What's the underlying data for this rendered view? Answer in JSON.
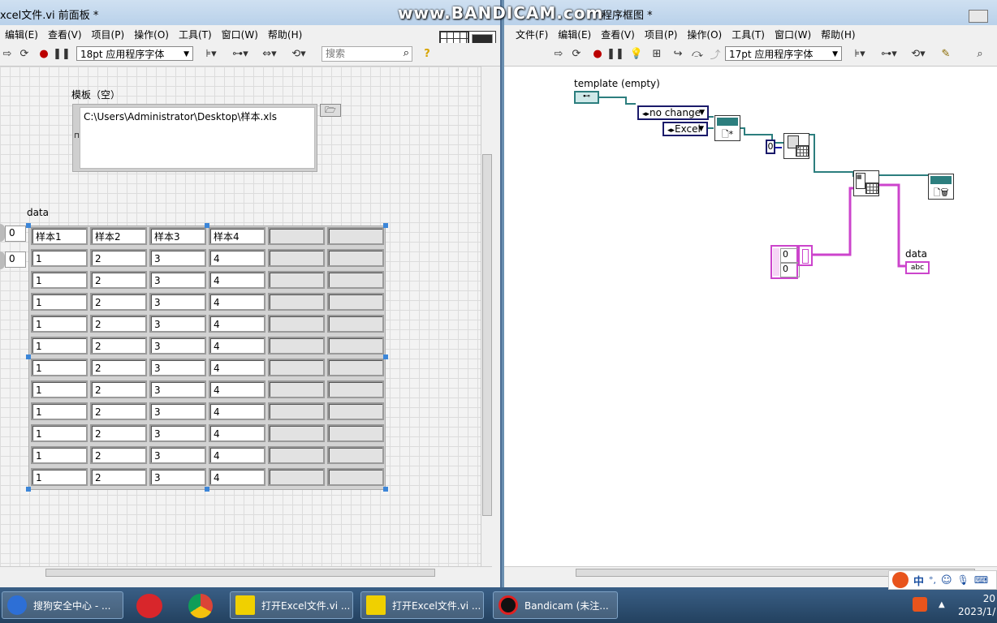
{
  "front_panel": {
    "title": "xcel文件.vi 前面板 *",
    "menu": [
      "编辑(E)",
      "查看(V)",
      "项目(P)",
      "操作(O)",
      "工具(T)",
      "窗口(W)",
      "帮助(H)"
    ],
    "font_combo": "18pt 应用程序字体",
    "search_placeholder": "搜索",
    "template_label": "模板（空）",
    "template_path": "C:\\Users\\Administrator\\Desktop\\样本.xls",
    "data_label": "data",
    "row_index": "0",
    "col_index": "0",
    "table_header": [
      "样本1",
      "样本2",
      "样本3",
      "样本4"
    ],
    "table_rows": [
      [
        "1",
        "2",
        "3",
        "4"
      ],
      [
        "1",
        "2",
        "3",
        "4"
      ],
      [
        "1",
        "2",
        "3",
        "4"
      ],
      [
        "1",
        "2",
        "3",
        "4"
      ],
      [
        "1",
        "2",
        "3",
        "4"
      ],
      [
        "1",
        "2",
        "3",
        "4"
      ],
      [
        "1",
        "2",
        "3",
        "4"
      ],
      [
        "1",
        "2",
        "3",
        "4"
      ],
      [
        "1",
        "2",
        "3",
        "4"
      ],
      [
        "1",
        "2",
        "3",
        "4"
      ],
      [
        "1",
        "2",
        "3",
        "4"
      ]
    ]
  },
  "block_diagram": {
    "title": "程序框图 *",
    "watermark": "www.BANDICAM.com",
    "menu": [
      "文件(F)",
      "编辑(E)",
      "查看(V)",
      "项目(P)",
      "操作(O)",
      "工具(T)",
      "窗口(W)",
      "帮助(H)"
    ],
    "font_combo": "17pt 应用程序字体",
    "template_label": "template (empty)",
    "no_change": "no change",
    "excel": "Excel",
    "zero_const": "0",
    "index_0": "0",
    "index_1": "0",
    "data_label": "data",
    "abc": "abc"
  },
  "taskbar": {
    "items": [
      "搜狗安全中心 - ...",
      "打开Excel文件.vi ...",
      "打开Excel文件.vi ...",
      "Bandicam (未注..."
    ],
    "tray_text": "中",
    "clock_line1": "20",
    "clock_line2": "2023/1/"
  }
}
